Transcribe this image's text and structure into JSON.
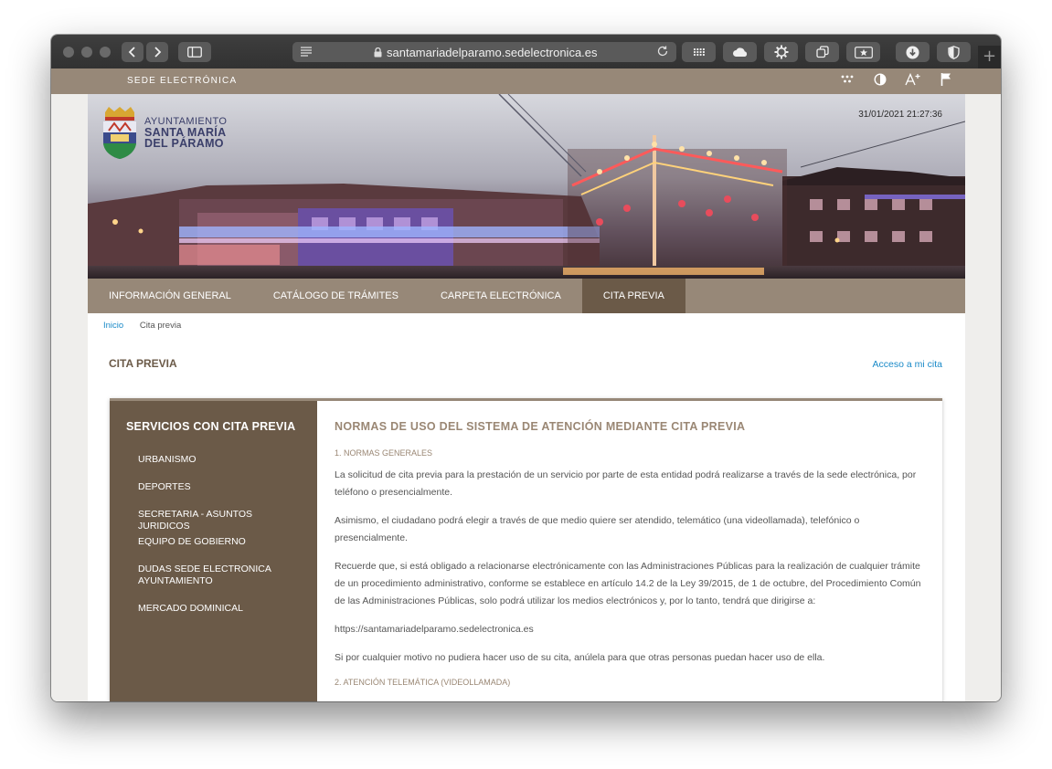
{
  "browser": {
    "url": "santamariadelparamo.sedelectronica.es"
  },
  "sede": {
    "label": "SEDE ELECTRÓNICA",
    "icons": [
      "grid-dots-icon",
      "contrast-icon",
      "text-size-icon",
      "flag-icon"
    ]
  },
  "header": {
    "datetime": "31/01/2021 21:27:36",
    "logo_line1": "AYUNTAMIENTO",
    "logo_line2": "SANTA MARÍA",
    "logo_line3": "DEL PÁRAMO"
  },
  "nav": {
    "items": [
      {
        "label": "INFORMACIÓN GENERAL"
      },
      {
        "label": "CATÁLOGO DE TRÁMITES"
      },
      {
        "label": "CARPETA ELECTRÓNICA"
      },
      {
        "label": "CITA PREVIA"
      }
    ],
    "active_index": 3
  },
  "breadcrumb": {
    "home": "Inicio",
    "current": "Cita previa"
  },
  "page": {
    "title": "CITA PREVIA",
    "access_link": "Acceso a mi cita"
  },
  "sidebar": {
    "title": "SERVICIOS CON CITA PREVIA",
    "items": [
      {
        "label": "URBANISMO"
      },
      {
        "label": "DEPORTES"
      },
      {
        "label": "SECRETARIA - ASUNTOS JURIDICOS"
      },
      {
        "label": "EQUIPO DE GOBIERNO"
      },
      {
        "label": "DUDAS SEDE ELECTRONICA AYUNTAMIENTO"
      },
      {
        "label": "MERCADO DOMINICAL"
      }
    ]
  },
  "main": {
    "title": "NORMAS DE USO DEL SISTEMA DE ATENCIÓN MEDIANTE CITA PREVIA",
    "section1": "1. NORMAS GENERALES",
    "p1": "La solicitud de cita previa para la prestación de un servicio por parte de esta entidad podrá realizarse a través de la sede electrónica, por teléfono o presencialmente.",
    "p2": "Asimismo, el ciudadano podrá elegir a través de que medio quiere ser atendido, telemático (una videollamada), telefónico o presencialmente.",
    "p3": "Recuerde que, si está obligado a relacionarse electrónicamente con las Administraciones Públicas para la realización de cualquier trámite de un procedimiento administrativo, conforme se establece en artículo 14.2 de la Ley 39/2015, de 1 de octubre, del Procedimiento Común de las Administraciones Públicas, solo podrá utilizar los medios electrónicos y, por lo tanto, tendrá que dirigirse a:",
    "p4": "https://santamariadelparamo.sedelectronica.es",
    "p5": "Si por cualquier motivo no pudiera hacer uso de su cita, anúlela para que otras personas puedan hacer uso de ella.",
    "section2": "2. ATENCIÓN TELEMÁTICA (VIDEOLLAMADA)"
  }
}
